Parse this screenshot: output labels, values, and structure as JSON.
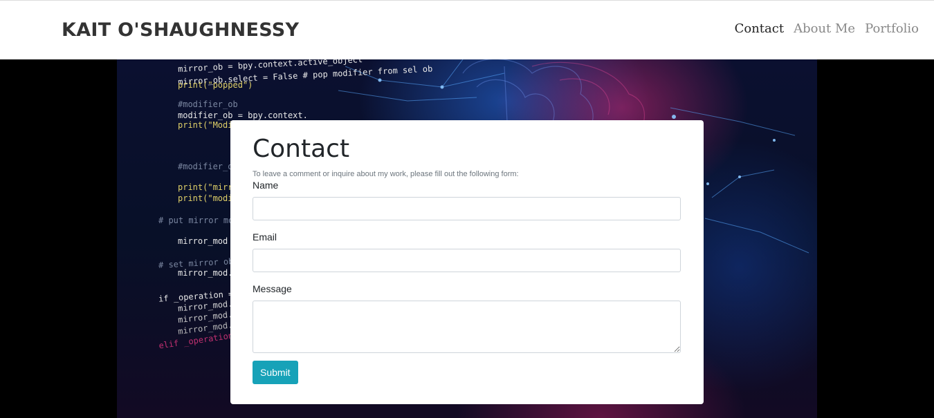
{
  "navbar": {
    "brand": "KAIT O'SHAUGHNESSY",
    "links": [
      {
        "label": "Contact",
        "active": true
      },
      {
        "label": "About Me",
        "active": false
      },
      {
        "label": "Portfolio",
        "active": false
      }
    ]
  },
  "hero": {
    "code_lines": [
      {
        "text": "mirror_ob = bpy.context.active_object",
        "color": "#e8e8e8"
      },
      {
        "text": "mirror_ob.select = False # pop modifier from sel ob",
        "color": "#e8e8e8"
      },
      {
        "text": "print(\"popped\")",
        "color": "#e0d068"
      },
      {
        "text": "#modifier_ob",
        "color": "#7a86a0"
      },
      {
        "text": "modifier_ob = bpy.context.",
        "color": "#e8e8e8"
      },
      {
        "text": "print(\"Modi",
        "color": "#e0d068"
      },
      {
        "text": "#modifier_o",
        "color": "#7a86a0"
      },
      {
        "text": "print(\"mirr",
        "color": "#e0d068"
      },
      {
        "text": "print(\"modi",
        "color": "#e0d068"
      },
      {
        "text": "# put mirror mo",
        "color": "#7a86a0"
      },
      {
        "text": "mirror_mod",
        "color": "#e8e8e8"
      },
      {
        "text": "# set mirror ob",
        "color": "#7a86a0"
      },
      {
        "text": "mirror_mod.",
        "color": "#e8e8e8"
      },
      {
        "text": "if _operation =",
        "color": "#e8e8e8"
      },
      {
        "text": "mirror_mod.",
        "color": "#d8d8d8"
      },
      {
        "text": "mirror_mod.",
        "color": "#c8c8c8"
      },
      {
        "text": "mirror_mod.",
        "color": "#b8b8b8"
      },
      {
        "text": "elif _operation",
        "color": "#c03070"
      }
    ]
  },
  "form": {
    "title": "Contact",
    "subtitle": "To leave a comment or inquire about my work, please fill out the following form:",
    "fields": {
      "name_label": "Name",
      "name_value": "",
      "email_label": "Email",
      "email_value": "",
      "message_label": "Message",
      "message_value": ""
    },
    "submit_label": "Submit"
  },
  "colors": {
    "accent": "#17a2b8",
    "nav_active": "#222222",
    "nav_inactive": "#888888"
  }
}
